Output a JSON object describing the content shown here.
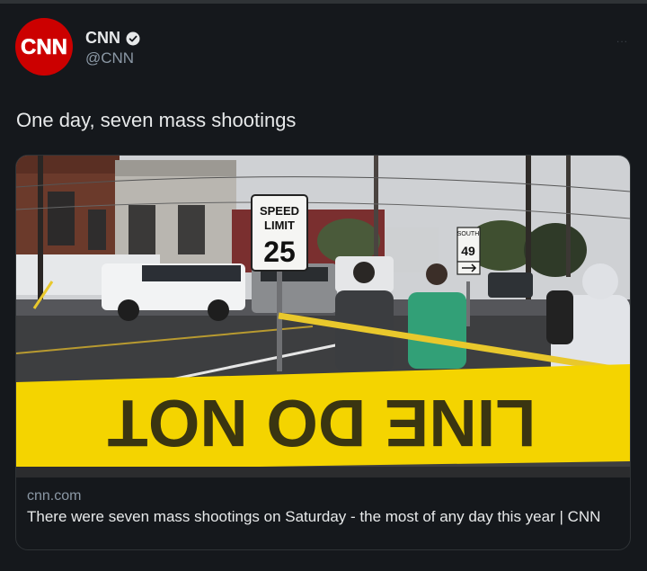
{
  "account": {
    "logo_text": "CNN",
    "name": "CNN",
    "handle": "@CNN",
    "verified": true
  },
  "more_menu": "...",
  "tweet": {
    "text": "One day, seven mass shootings"
  },
  "card": {
    "domain": "cnn.com",
    "title": "There were seven mass shootings on Saturday - the most of any day this year | CNN",
    "image": {
      "sign_top": "SPEED",
      "sign_mid": "LIMIT",
      "sign_num": "25",
      "route_direction": "SOUTH",
      "route_number": "49",
      "tape_text": "LINE DO NOT"
    }
  },
  "colors": {
    "background": "#15181c",
    "brand": "#cc0000",
    "muted_text": "#8b98a5",
    "tape": "#f4d400"
  }
}
